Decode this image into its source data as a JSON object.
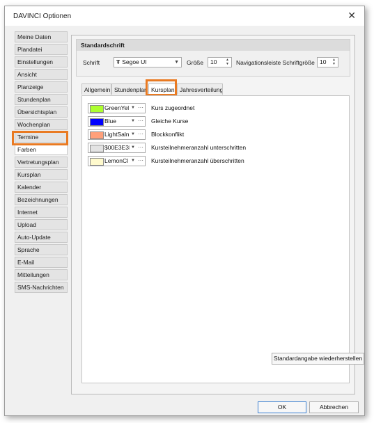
{
  "window": {
    "title": "DAVINCI Optionen",
    "close_label": "✕"
  },
  "sidebar": {
    "items": [
      {
        "label": "Meine Daten"
      },
      {
        "label": "Plandatei"
      },
      {
        "label": "Einstellungen"
      },
      {
        "label": "Ansicht"
      },
      {
        "label": "Planzeige"
      },
      {
        "label": "Stundenplan"
      },
      {
        "label": "Übersichtsplan"
      },
      {
        "label": "Wochenplan"
      },
      {
        "label": "Termine"
      },
      {
        "label": "Farben"
      },
      {
        "label": "Vertretungsplan"
      },
      {
        "label": "Kursplan"
      },
      {
        "label": "Kalender"
      },
      {
        "label": "Bezeichnungen"
      },
      {
        "label": "Internet"
      },
      {
        "label": "Upload"
      },
      {
        "label": "Auto-Update"
      },
      {
        "label": "Sprache"
      },
      {
        "label": "E-Mail"
      },
      {
        "label": "Mitteilungen"
      },
      {
        "label": "SMS-Nachrichten"
      }
    ],
    "selected": "Farben"
  },
  "font_group": {
    "header": "Standardschrift",
    "font_label": "Schrift",
    "font_icon": "Ŧ",
    "font_value": "Segoe UI",
    "size_label": "Größe",
    "size_value": "10",
    "nav_size_label": "Navigationsleiste Schriftgröße",
    "nav_size_value": "10"
  },
  "tabs": [
    {
      "label": "Allgemein"
    },
    {
      "label": "Stundenplan"
    },
    {
      "label": "Kursplan"
    },
    {
      "label": "Jahresverteilung"
    }
  ],
  "active_tab": "Kursplan",
  "colors": [
    {
      "name": "GreenYel",
      "hex": "#adff2f",
      "description": "Kurs zugeordnet"
    },
    {
      "name": "Blue",
      "hex": "#0000ff",
      "description": "Gleiche Kurse"
    },
    {
      "name": "LightSaln",
      "hex": "#ffa07a",
      "description": "Blockkonflikt"
    },
    {
      "name": "$00E3E3E",
      "hex": "#e3e3e3",
      "description": "Kursteilnehmeranzahl unterschritten"
    },
    {
      "name": "LemonCl",
      "hex": "#fffacd",
      "description": "Kursteilnehmeranzahl überschritten"
    }
  ],
  "restore_button": "Standardangabe wiederherstellen",
  "footer": {
    "ok": "OK",
    "cancel": "Abbrechen"
  },
  "accent": "#e97a22"
}
